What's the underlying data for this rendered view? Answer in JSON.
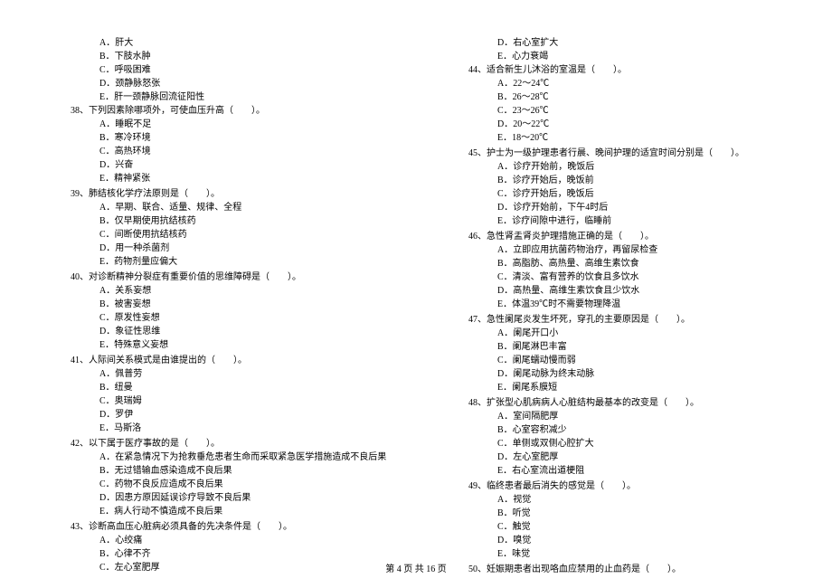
{
  "left_column": {
    "pre_options": [
      "A．肝大",
      "B．下肢水肿",
      "C．呼吸困难",
      "D．颈静脉怒张",
      "E．肝一颈静脉回流征阳性"
    ],
    "questions": [
      {
        "num": "38、",
        "text": "下列因素除哪项外，可使血压升高（　　）。",
        "options": [
          "A．睡眠不足",
          "B．寒冷环境",
          "C．高热环境",
          "D．兴奋",
          "E．精神紧张"
        ]
      },
      {
        "num": "39、",
        "text": "肺结核化学疗法原则是（　　）。",
        "options": [
          "A．早期、联合、适量、规律、全程",
          "B．仅早期使用抗结核药",
          "C．间断使用抗结核药",
          "D．用一种杀菌剂",
          "E．药物剂量应偏大"
        ]
      },
      {
        "num": "40、",
        "text": "对诊断精神分裂症有重要价值的思维障碍是（　　）。",
        "options": [
          "A．关系妄想",
          "B．被害妄想",
          "C．原发性妄想",
          "D．象征性思维",
          "E．特殊意义妄想"
        ]
      },
      {
        "num": "41、",
        "text": "人际间关系模式是由谁提出的（　　）。",
        "options": [
          "A．佩普劳",
          "B．纽曼",
          "C．奥瑞姆",
          "D．罗伊",
          "E．马斯洛"
        ]
      },
      {
        "num": "42、",
        "text": "以下属于医疗事故的是（　　）。",
        "options": [
          "A．在紧急情况下为抢救垂危患者生命而采取紧急医学措施造成不良后果",
          "B．无过错输血感染造成不良后果",
          "C．药物不良反应造成不良后果",
          "D．因患方原因延误诊疗导致不良后果",
          "E．病人行动不慎造成不良后果"
        ]
      },
      {
        "num": "43、",
        "text": "诊断高血压心脏病必须具备的先决条件是（　　）。",
        "options": [
          "A．心绞痛",
          "B．心律不齐",
          "C．左心室肥厚"
        ]
      }
    ]
  },
  "right_column": {
    "pre_options": [
      "D．右心室扩大",
      "E．心力衰竭"
    ],
    "questions": [
      {
        "num": "44、",
        "text": "适合新生儿沐浴的室温是（　　）。",
        "options": [
          "A．22～24℃",
          "B．26～28℃",
          "C．23～26℃",
          "D．20～22℃",
          "E．18～20℃"
        ]
      },
      {
        "num": "45、",
        "text": "护士为一级护理患者行晨、晚间护理的适宜时间分别是（　　）。",
        "options": [
          "A．诊疗开始前，晚饭后",
          "B．诊疗开始后，晚饭前",
          "C．诊疗开始后，晚饭后",
          "D．诊疗开始前，下午4时后",
          "E．诊疗间隙中进行，临睡前"
        ]
      },
      {
        "num": "46、",
        "text": "急性肾盂肾炎护理措施正确的是（　　）。",
        "options": [
          "A．立即应用抗菌药物治疗，再留尿检查",
          "B．高脂肪、高热量、高维生素饮食",
          "C．清淡、富有营养的饮食且多饮水",
          "D．高热量、高维生素饮食且少饮水",
          "E．体温39℃时不需要物理降温"
        ]
      },
      {
        "num": "47、",
        "text": "急性阑尾炎发生坏死，穿孔的主要原因是（　　）。",
        "options": [
          "A．阑尾开口小",
          "B．阑尾淋巴丰富",
          "C．阑尾蠕动慢而弱",
          "D．阑尾动脉为终末动脉",
          "E．阑尾系膜短"
        ]
      },
      {
        "num": "48、",
        "text": "扩张型心肌病病人心脏结构最基本的改变是（　　）。",
        "options": [
          "A．室间隔肥厚",
          "B．心室容积减少",
          "C．单侧或双侧心腔扩大",
          "D．左心室肥厚",
          "E．右心室流出道梗阻"
        ]
      },
      {
        "num": "49、",
        "text": "临终患者最后消失的感觉是（　　）。",
        "options": [
          "A．视觉",
          "B．听觉",
          "C．触觉",
          "D．嗅觉",
          "E．味觉"
        ]
      },
      {
        "num": "50、",
        "text": "妊娠期患者出现咯血应禁用的止血药是（　　）。",
        "options": []
      }
    ]
  },
  "footer": "第 4 页 共 16 页"
}
